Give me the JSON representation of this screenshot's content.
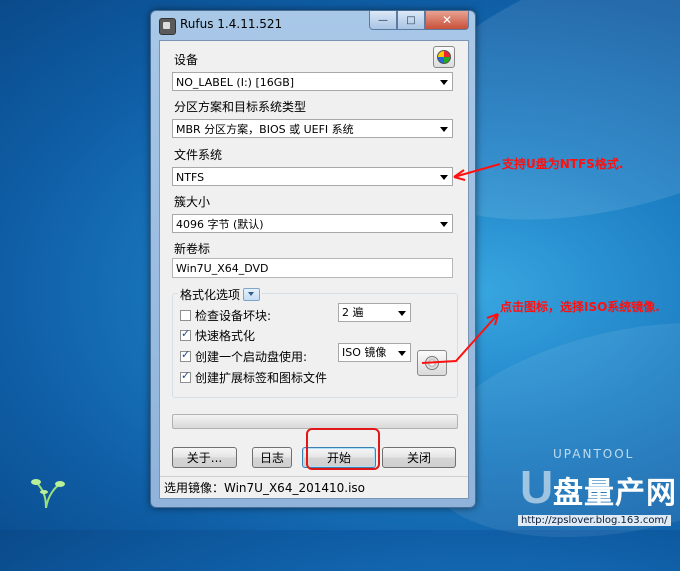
{
  "window": {
    "title": "Rufus 1.4.11.521",
    "min": "—",
    "max": "□",
    "close": "✕"
  },
  "device": {
    "label": "设备",
    "value": "NO_LABEL (I:) [16GB]"
  },
  "partition": {
    "label": "分区方案和目标系统类型",
    "value": "MBR 分区方案，BIOS 或 UEFI 系统"
  },
  "filesystem": {
    "label": "文件系统",
    "value": "NTFS"
  },
  "cluster": {
    "label": "簇大小",
    "value": "4096 字节 (默认)"
  },
  "volume": {
    "label": "新卷标",
    "value": "Win7U_X64_DVD"
  },
  "format_options": {
    "title": "格式化选项",
    "bad_blocks": {
      "label": "检查设备坏块:",
      "checked": false,
      "passes": "2 遍"
    },
    "quick_format": {
      "label": "快速格式化",
      "checked": true
    },
    "bootable": {
      "label": "创建一个启动盘使用:",
      "checked": true,
      "type": "ISO 镜像"
    },
    "extended_label": {
      "label": "创建扩展标签和图标文件",
      "checked": true
    }
  },
  "buttons": {
    "about": "关于...",
    "log": "日志",
    "start": "开始",
    "close": "关闭"
  },
  "status": "选用镜像：Win7U_X64_201410.iso",
  "annotations": {
    "ntfs_note": "支持U盘为NTFS格式.",
    "iso_note": "点击图标，选择ISO系统镜像."
  },
  "watermark": {
    "letter": "U",
    "title": "盘量产网",
    "domain": "UPANTOOL",
    "url": "http://zpslover.blog.163.com/"
  }
}
